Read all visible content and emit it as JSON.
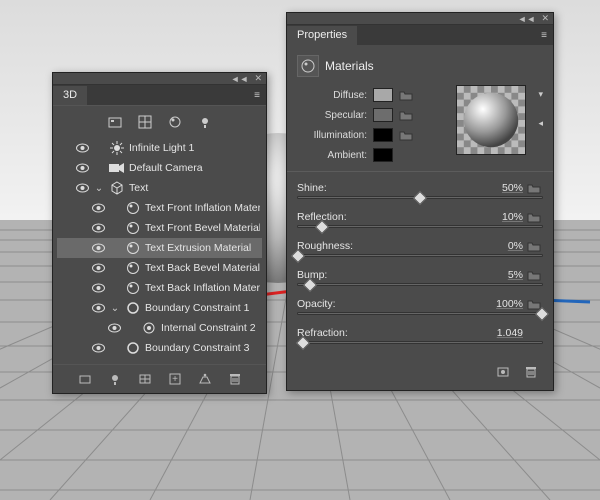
{
  "panels": {
    "threeD": {
      "title": "3D",
      "tree": [
        {
          "k": "light",
          "label": "Infinite Light 1",
          "icon": "sun",
          "depth": 1,
          "twist": "",
          "sel": false
        },
        {
          "k": "camera",
          "label": "Default Camera",
          "icon": "camera",
          "depth": 1,
          "twist": "",
          "sel": false
        },
        {
          "k": "text",
          "label": "Text",
          "icon": "mesh",
          "depth": 1,
          "twist": "down",
          "sel": false
        },
        {
          "k": "matFrontInf",
          "label": "Text Front Inflation Material",
          "icon": "mat",
          "depth": 2,
          "twist": "",
          "sel": false
        },
        {
          "k": "matFrontBev",
          "label": "Text Front Bevel Material",
          "icon": "mat",
          "depth": 2,
          "twist": "",
          "sel": false
        },
        {
          "k": "matExtr",
          "label": "Text Extrusion Material",
          "icon": "mat",
          "depth": 2,
          "twist": "",
          "sel": true
        },
        {
          "k": "matBackBev",
          "label": "Text Back Bevel Material",
          "icon": "mat",
          "depth": 2,
          "twist": "",
          "sel": false
        },
        {
          "k": "matBackInf",
          "label": "Text Back Inflation Material",
          "icon": "mat",
          "depth": 2,
          "twist": "",
          "sel": false
        },
        {
          "k": "bc1",
          "label": "Boundary Constraint 1",
          "icon": "ring",
          "depth": 2,
          "twist": "down",
          "sel": false
        },
        {
          "k": "ic2",
          "label": "Internal Constraint 2",
          "icon": "target",
          "depth": 3,
          "twist": "",
          "sel": false
        },
        {
          "k": "bc3",
          "label": "Boundary Constraint 3",
          "icon": "ring",
          "depth": 2,
          "twist": "",
          "sel": false
        }
      ]
    },
    "properties": {
      "title": "Properties",
      "section": "Materials",
      "swatches": {
        "diffuse": {
          "label": "Diffuse:",
          "color": "#a8a8a8"
        },
        "specular": {
          "label": "Specular:",
          "color": "#6d6d6d"
        },
        "illumination": {
          "label": "Illumination:",
          "color": "#000000"
        },
        "ambient": {
          "label": "Ambient:",
          "color": "#000000"
        }
      },
      "sliders": {
        "shine": {
          "label": "Shine:",
          "value": "50%",
          "pos": 50,
          "folder": true
        },
        "reflection": {
          "label": "Reflection:",
          "value": "10%",
          "pos": 10,
          "folder": true
        },
        "roughness": {
          "label": "Roughness:",
          "value": "0%",
          "pos": 0,
          "folder": true
        },
        "bump": {
          "label": "Bump:",
          "value": "5%",
          "pos": 5,
          "folder": true
        },
        "opacity": {
          "label": "Opacity:",
          "value": "100%",
          "pos": 100,
          "folder": true
        },
        "refraction": {
          "label": "Refraction:",
          "value": "1.049",
          "pos": 2,
          "folder": false
        }
      }
    }
  }
}
